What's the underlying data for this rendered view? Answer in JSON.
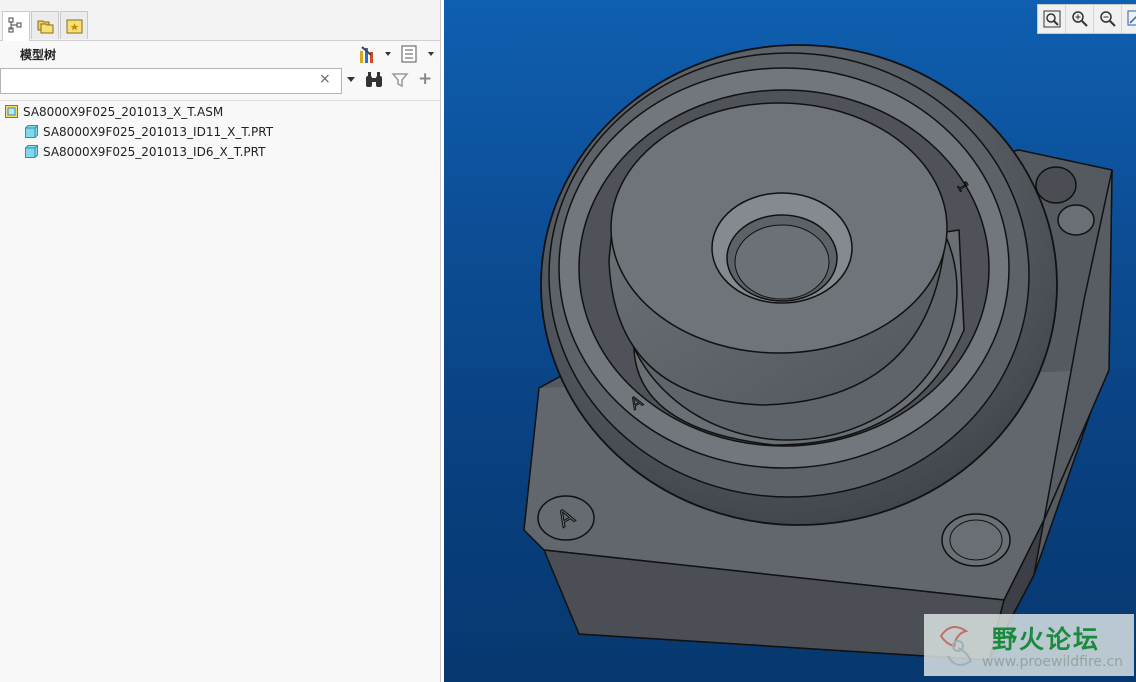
{
  "panel": {
    "title": "模型树",
    "search": {
      "value": "",
      "placeholder": "",
      "clear": "×"
    },
    "add": "+"
  },
  "tree": {
    "items": [
      {
        "label": "SA8000X9F025_201013_X_T.ASM",
        "type": "assembly"
      },
      {
        "label": "SA8000X9F025_201013_ID11_X_T.PRT",
        "type": "part"
      },
      {
        "label": "SA8000X9F025_201013_ID6_X_T.PRT",
        "type": "part"
      }
    ]
  },
  "viewport": {
    "background": "#0c4d95",
    "model_marks": [
      "A",
      "A",
      "1"
    ]
  },
  "watermark": {
    "title": "野火论坛",
    "url": "www.proewildfire.cn"
  }
}
